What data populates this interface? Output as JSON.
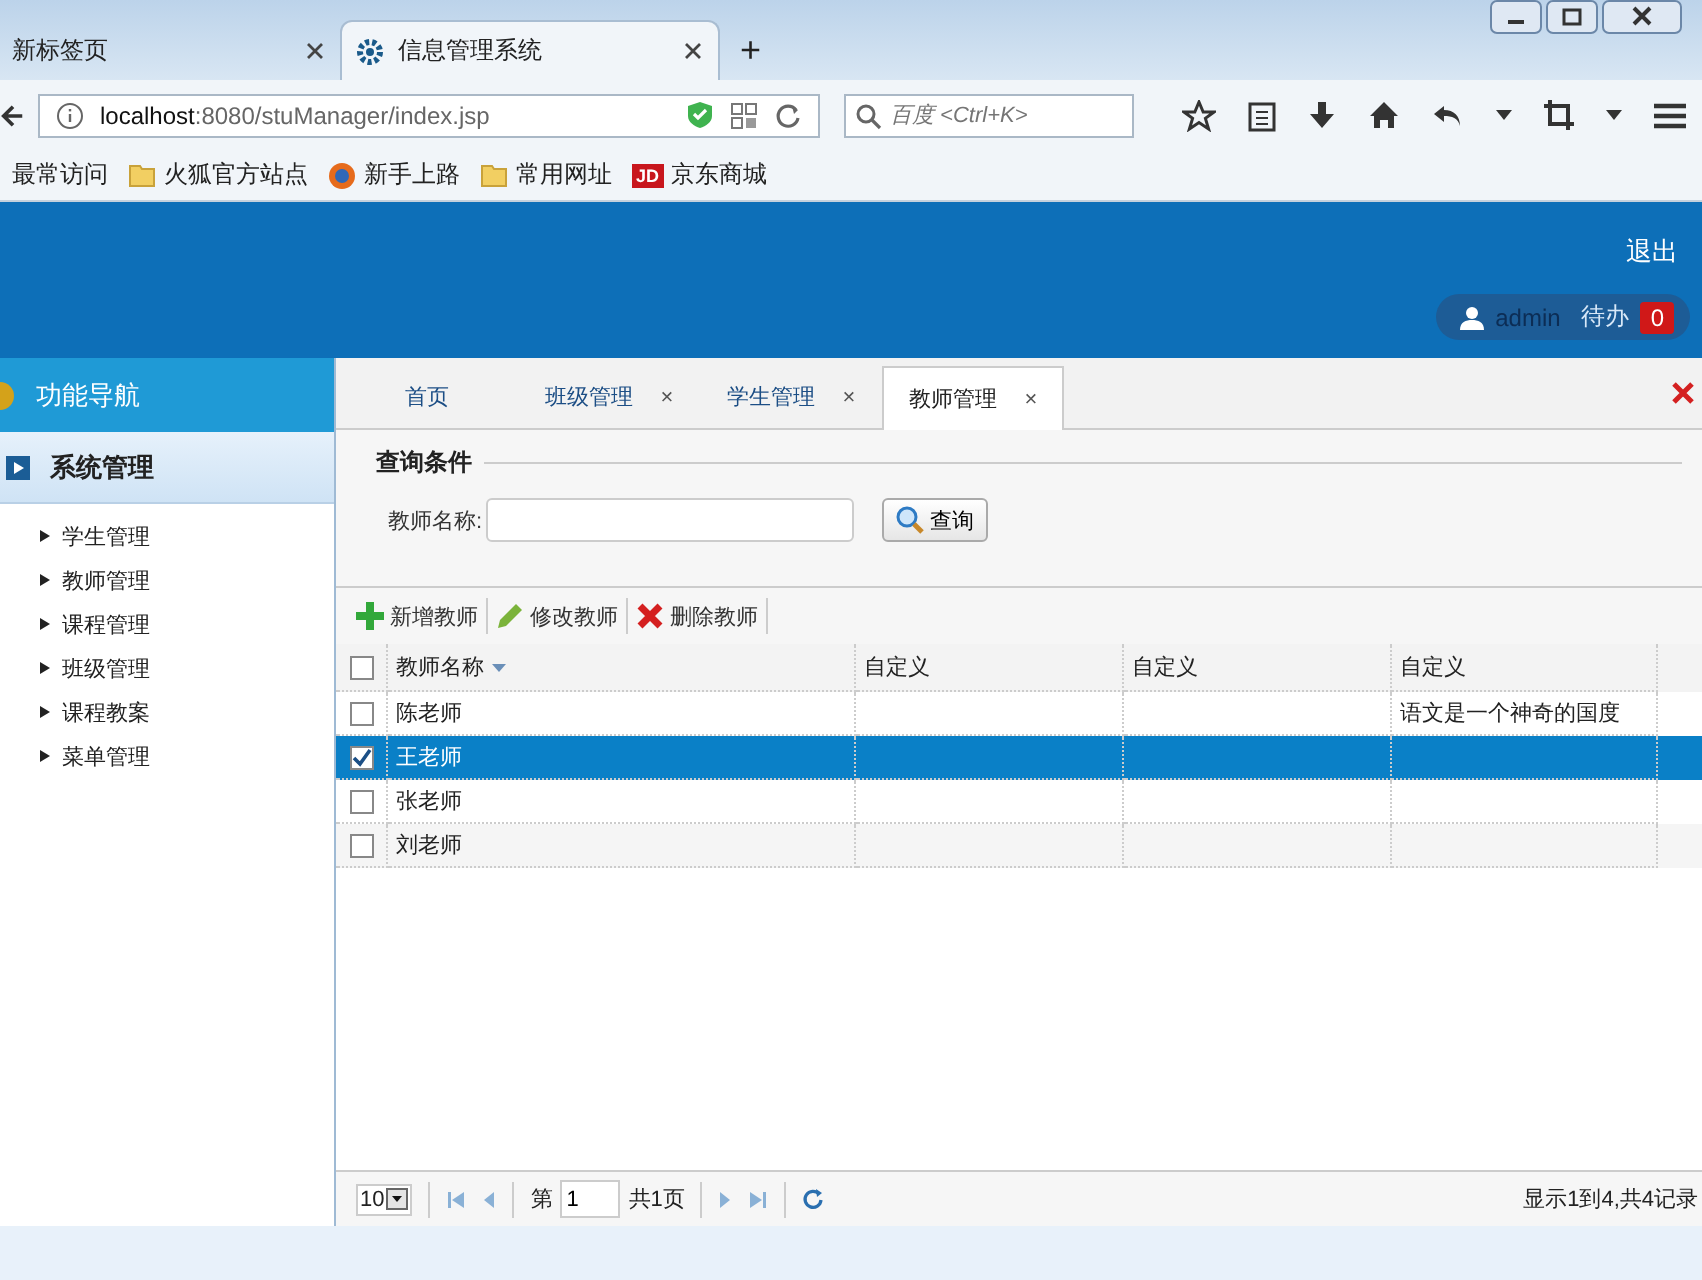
{
  "browser": {
    "tabs": [
      {
        "title": "新标签页",
        "selected": false
      },
      {
        "title": "信息管理系统",
        "selected": true
      }
    ],
    "new_tab": "+",
    "url_host": "localhost",
    "url_rest": ":8080/stuManager/index.jsp",
    "search": {
      "placeholder": "百度 <Ctrl+K>"
    },
    "bookmarks": [
      {
        "label": "最常访问",
        "kind": "plain"
      },
      {
        "label": "火狐官方站点",
        "kind": "folder"
      },
      {
        "label": "新手上路",
        "kind": "globe"
      },
      {
        "label": "常用网址",
        "kind": "folder"
      },
      {
        "label": "京东商城",
        "kind": "badge",
        "badge": "JD"
      }
    ]
  },
  "header": {
    "logout": "退出",
    "user": "admin",
    "todo": "待办",
    "todo_count": "0"
  },
  "sidebar": {
    "title": "功能导航",
    "group": {
      "label": "系统管理",
      "expanded": true,
      "items": [
        {
          "label": "学生管理"
        },
        {
          "label": "教师管理"
        },
        {
          "label": "课程管理"
        },
        {
          "label": "班级管理"
        },
        {
          "label": "课程教案"
        },
        {
          "label": "菜单管理"
        }
      ]
    }
  },
  "tabs": [
    {
      "label": "首页",
      "selected": false,
      "closable": false
    },
    {
      "label": "班级管理",
      "selected": false,
      "closable": true
    },
    {
      "label": "学生管理",
      "selected": false,
      "closable": true
    },
    {
      "label": "教师管理",
      "selected": true,
      "closable": true
    }
  ],
  "tab_close": "×",
  "query": {
    "legend": "查询条件",
    "label": "教师名称:",
    "button": "查询"
  },
  "toolbar": [
    {
      "label": "新增教师",
      "kind": "add"
    },
    {
      "label": "修改教师",
      "kind": "edit"
    },
    {
      "label": "删除教师",
      "kind": "delete"
    }
  ],
  "table": {
    "header_checked": false,
    "columns": [
      {
        "label": "教师名称",
        "sortable": true
      },
      {
        "label": "自定义",
        "sortable": false
      },
      {
        "label": "自定义",
        "sortable": false
      },
      {
        "label": "自定义",
        "sortable": false
      }
    ],
    "rows": [
      {
        "cells": [
          "陈老师",
          "",
          "",
          "语文是一个神奇的国度"
        ],
        "checked": false,
        "selected": false
      },
      {
        "cells": [
          "王老师",
          "",
          "",
          ""
        ],
        "checked": true,
        "selected": true
      },
      {
        "cells": [
          "张老师",
          "",
          "",
          ""
        ],
        "checked": false,
        "selected": false
      },
      {
        "cells": [
          "刘老师",
          "",
          "",
          ""
        ],
        "checked": false,
        "selected": false
      }
    ]
  },
  "pager": {
    "page_size": "10",
    "page_prefix": "第",
    "page": "1",
    "total_pages": "共1页",
    "summary": "显示1到4,共4记录"
  }
}
